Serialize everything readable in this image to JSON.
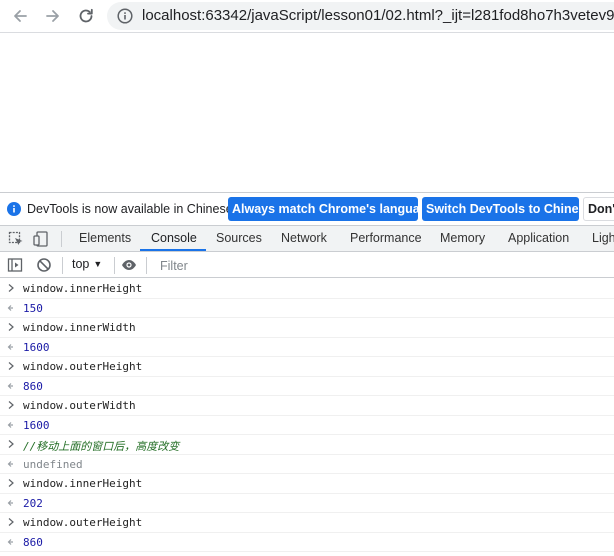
{
  "browser": {
    "url": "localhost:63342/javaScript/lesson01/02.html?_ijt=l281fod8ho7h3vetev9"
  },
  "infobar": {
    "message": "DevTools is now available in Chinese!",
    "match_language_label": "Always match Chrome's language",
    "switch_label": "Switch DevTools to Chinese",
    "dont_show_label": "Don't"
  },
  "devtools": {
    "tabs": [
      {
        "label": "Elements",
        "active": false
      },
      {
        "label": "Console",
        "active": true
      },
      {
        "label": "Sources",
        "active": false
      },
      {
        "label": "Network",
        "active": false
      },
      {
        "label": "Performance",
        "active": false
      },
      {
        "label": "Memory",
        "active": false
      },
      {
        "label": "Application",
        "active": false
      },
      {
        "label": "Ligh",
        "active": false
      }
    ],
    "accent_color": "#1a73e8"
  },
  "console_toolbar": {
    "context": "top",
    "filter_placeholder": "Filter"
  },
  "console_log": [
    {
      "kind": "input",
      "text": "window.innerHeight"
    },
    {
      "kind": "number",
      "text": "150"
    },
    {
      "kind": "input",
      "text": "window.innerWidth"
    },
    {
      "kind": "number",
      "text": "1600"
    },
    {
      "kind": "input",
      "text": "window.outerHeight"
    },
    {
      "kind": "number",
      "text": "860"
    },
    {
      "kind": "input",
      "text": "window.outerWidth"
    },
    {
      "kind": "number",
      "text": "1600"
    },
    {
      "kind": "comment",
      "text": "//移动上面的窗口后，高度改变"
    },
    {
      "kind": "undef",
      "text": "undefined"
    },
    {
      "kind": "input",
      "text": "window.innerHeight"
    },
    {
      "kind": "number",
      "text": "202"
    },
    {
      "kind": "input",
      "text": "window.outerHeight"
    },
    {
      "kind": "number",
      "text": "860"
    }
  ]
}
